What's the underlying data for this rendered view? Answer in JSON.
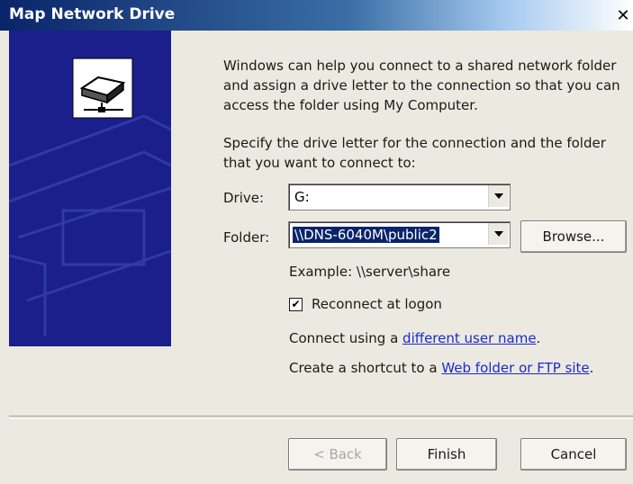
{
  "window": {
    "title": "Map Network Drive",
    "close_glyph": "✕"
  },
  "intro_text": "Windows can help you connect to a shared network folder and assign a drive letter to the connection so that you can access the folder using My Computer.",
  "instruction_text": "Specify the drive letter for the connection and the folder that you want to connect to:",
  "drive": {
    "label": "Drive:",
    "value": "G:"
  },
  "folder": {
    "label": "Folder:",
    "value": "\\\\DNS-6040M\\public2",
    "browse_label": "Browse..."
  },
  "example_text": "Example: \\\\server\\share",
  "reconnect": {
    "label": "Reconnect at logon",
    "checked": true,
    "check_glyph": "✔"
  },
  "connect_line": {
    "prefix": "Connect using a ",
    "link": "different user name",
    "suffix": "."
  },
  "shortcut_line": {
    "prefix": "Create a shortcut to a ",
    "link": "Web folder or FTP site",
    "suffix": "."
  },
  "buttons": {
    "back": "< Back",
    "finish": "Finish",
    "cancel": "Cancel"
  },
  "icons": {
    "wizard_image": "network-drive-icon",
    "close": "close-icon",
    "dropdown": "chevron-down-icon"
  },
  "colors": {
    "side_panel": "#1a1f8c",
    "link": "#1a2ad0",
    "selection": "#0a246a"
  }
}
